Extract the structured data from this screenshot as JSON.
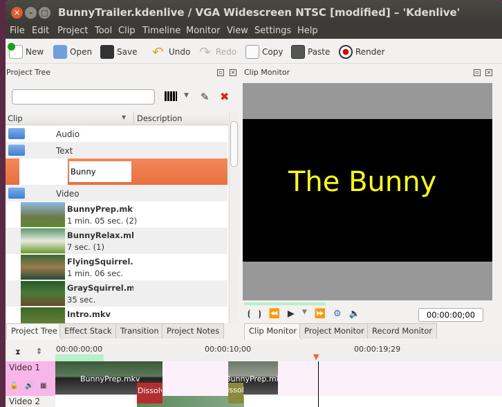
{
  "window": {
    "title": "BunnyTrailer.kdenlive / VGA Widescreen NTSC [modified] – 'Kdenlive'"
  },
  "menu": [
    "File",
    "Edit",
    "Project",
    "Tool",
    "Clip",
    "Timeline",
    "Monitor",
    "View",
    "Settings",
    "Help"
  ],
  "toolbar": {
    "new": "New",
    "open": "Open",
    "save": "Save",
    "undo": "Undo",
    "redo": "Redo",
    "copy": "Copy",
    "paste": "Paste",
    "render": "Render"
  },
  "project_tree": {
    "title": "Project Tree",
    "search_value": "",
    "col_clip": "Clip",
    "col_description": "Description",
    "folders": {
      "audio": "Audio",
      "text": "Text",
      "video": "Video"
    },
    "editing_value": "Bunny",
    "clips": [
      {
        "name": "BunnyPrep.mkv",
        "duration": "1 min. 05 sec. (2)"
      },
      {
        "name": "BunnyRelax.mkv",
        "duration": "7 sec. (1)"
      },
      {
        "name": "FlyingSquirrel.mkv",
        "duration": "1 min. 06 sec."
      },
      {
        "name": "GraySquirrel.mkv",
        "duration": "35 sec."
      },
      {
        "name": "Intro.mkv",
        "duration": ""
      }
    ]
  },
  "left_tabs": [
    "Project Tree",
    "Effect Stack",
    "Transition",
    "Project Notes"
  ],
  "clip_monitor": {
    "title": "Clip Monitor",
    "overlay_text": "The Bunny",
    "timecode": "00:00:00;00",
    "text_color": "#ffff00"
  },
  "monitor_tabs": [
    "Clip Monitor",
    "Project Monitor",
    "Record Monitor"
  ],
  "timeline": {
    "ruler": [
      "00:00:00;00",
      "00:00:10;00",
      "00:00:19;29"
    ],
    "tracks": [
      {
        "name": "Video 1",
        "clips": [
          "BunnyPrep.mkv",
          "BunnyPrep.mkv"
        ],
        "transitions": [
          "Dissolve",
          "Dissolve"
        ]
      },
      {
        "name": "Video 2"
      }
    ]
  },
  "colors": {
    "accent": "#f07746",
    "track_header": "#f8b6e8",
    "track_bg": "#fcf0fa"
  }
}
